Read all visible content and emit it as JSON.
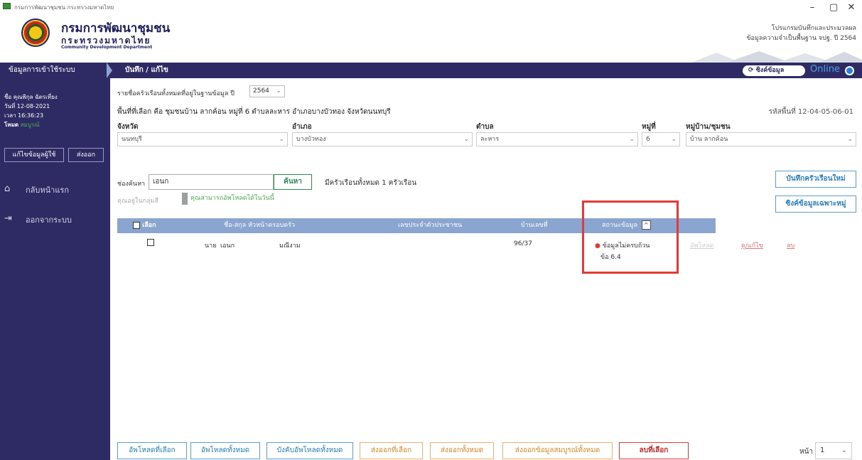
{
  "window": {
    "title": "กรมการพัฒนาชุมชน กระทรวงมหาดไทย",
    "minimize": "–",
    "restore": "▢",
    "close": "✕"
  },
  "header": {
    "org_name": "กรมการพัฒนาชุมชน",
    "ministry": "กระทรวงมหาดไทย",
    "dept_en": "Community Development Department",
    "program_line1": "โปรแกรมบันทึกและประมวลผล",
    "program_line2": "ข้อมูลความจำเป็นพื้นฐาน จปฐ. ปี 2564"
  },
  "nav": {
    "left_label": "ข้อมูลการเข้าใช้ระบบ",
    "page_title": "บันทึก / แก้ไข",
    "sync_label": "ซิงค์ข้อมูล",
    "sync_icon": "⟳",
    "online_label": "Online",
    "online_color": "#4fa3e3"
  },
  "sidebar": {
    "user_line": "ชื่อ คุณพิกุล ฉัตรเที่ยง",
    "date_line": "วันที่ 12-08-2021",
    "time_line": "เวลา 16:36:23",
    "mode_label": "โหมด",
    "mode_value": "สมบูรณ์",
    "edit_user_btn": "แก้ไขข้อมูลผู้ใช้",
    "export_btn": "ส่งออก",
    "home_label": "กลับหน้าแรก",
    "home_icon": "⌂",
    "logout_label": "ออกจากระบบ",
    "logout_icon": "⇥"
  },
  "filters": {
    "year_prefix": "รายชื่อครัวเรือนทั้งหมดที่อยู่ในฐานข้อมูล ปี",
    "year_value": "2564",
    "area_text": "พื้นที่ที่เลือก คือ ชุมชนบ้าน ลากค้อน หมู่ที่ 6 ตำบลละหาร อำเภอบางบัวทอง จังหวัดนนทบุรี",
    "area_code": "รหัสพื้นที่ 12-04-05-06-01",
    "province_label": "จังหวัด",
    "province_value": "นนทบุรี",
    "district_label": "อำเภอ",
    "district_value": "บางบัวทอง",
    "subdistrict_label": "ตำบล",
    "subdistrict_value": "ละหาร",
    "moo_label": "หมู่ที่",
    "moo_value": "6",
    "village_label": "หมู่บ้าน/ชุมชน",
    "village_value": "บ้าน ลากค้อน"
  },
  "search": {
    "label": "ช่องค้นหา",
    "value": "เอนก",
    "button": "ค้นหา",
    "count_text": "มีครัวเรือนทั้งหมด 1 ครัวเรือน",
    "online_user_text": "คุณอยู่ในกลุ่มสี",
    "download_note": "คุณสามารถอัพโหลดได้ในวันนี้",
    "new_household_btn": "บันทึกครัวเรือนใหม่",
    "sync_village_btn": "ซิงค์ข้อมูลเฉพาะหมู่"
  },
  "table": {
    "headers": {
      "select": "เลือก",
      "name": "ชื่อ-สกุล หัวหน้าครอบครัว",
      "id": "เลขประจำตัวประชาชน",
      "house_no": "บ้านเลขที่",
      "status": "สถานะข้อมูล",
      "sort_icon": "^"
    },
    "rows": [
      {
        "title": "นาย",
        "first_name": "เอนก",
        "last_name": "มณีงาม",
        "house_no": "96/37",
        "status_line1": "ข้อมูลไม่ครบถ้วน",
        "status_line2": "ข้อ 6.4",
        "status_dot": "●",
        "action_upload": "อัพโหลด",
        "action_edit": "ดู/แก้ไข",
        "action_delete": "ลบ"
      }
    ]
  },
  "footer": {
    "upload_selected": "อัพโหลดที่เลือก",
    "upload_all": "อัพโหลดทั้งหมด",
    "force_upload_all": "บังคับอัพโหลดทั้งหมด",
    "export_selected": "ส่งออกที่เลือก",
    "export_all": "ส่งออกทั้งหมด",
    "export_complete_all": "ส่งออกข้อมูลสมบูรณ์ทั้งหมด",
    "delete_selected": "ลบที่เลือก",
    "page_label": "หน้า",
    "page_value": "1"
  }
}
